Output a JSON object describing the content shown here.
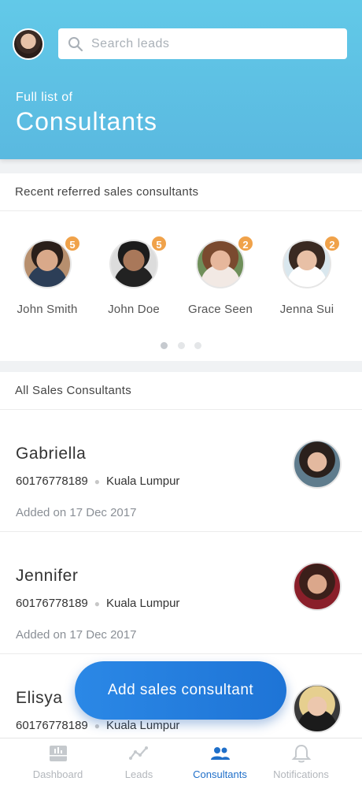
{
  "header": {
    "search_placeholder": "Search leads",
    "subtitle": "Full list of",
    "title": "Consultants"
  },
  "recent": {
    "title": "Recent referred sales consultants",
    "people": [
      {
        "name": "John Smith",
        "badge": "5"
      },
      {
        "name": "John Doe",
        "badge": "5"
      },
      {
        "name": "Grace Seen",
        "badge": "2"
      },
      {
        "name": "Jenna Sui",
        "badge": "2"
      }
    ]
  },
  "all": {
    "title": "All Sales Consultants",
    "rows": [
      {
        "name": "Gabriella",
        "phone": "60176778189",
        "city": "Kuala Lumpur",
        "added": "Added on 17 Dec 2017"
      },
      {
        "name": "Jennifer",
        "phone": "60176778189",
        "city": "Kuala Lumpur",
        "added": "Added on 17 Dec 2017"
      },
      {
        "name": "Elisya",
        "phone": "60176778189",
        "city": "Kuala Lumpur",
        "added": ""
      }
    ]
  },
  "fab_label": "Add sales consultant",
  "tabs": [
    {
      "label": "Dashboard",
      "icon": "dashboard-icon"
    },
    {
      "label": "Leads",
      "icon": "leads-chart-icon"
    },
    {
      "label": "Consultants",
      "icon": "people-icon"
    },
    {
      "label": "Notifications",
      "icon": "bell-icon"
    }
  ],
  "colors": {
    "header_top": "#62c9e8",
    "accent_blue": "#1f6fc9",
    "badge_orange": "#f0a24a",
    "fab_blue": "#2b88e6"
  }
}
